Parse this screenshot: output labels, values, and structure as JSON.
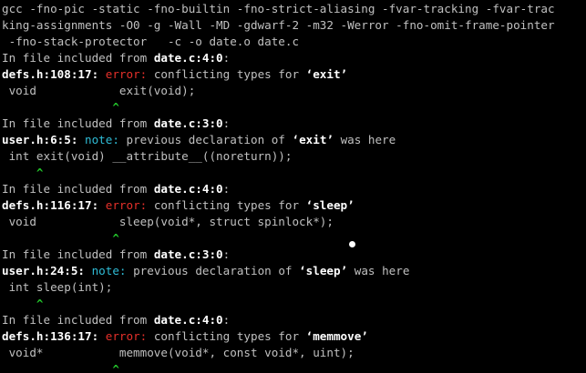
{
  "terminal": {
    "command": [
      "gcc -fno-pic -static -fno-builtin -fno-strict-aliasing -fvar-tracking -fvar-trac",
      "king-assignments -O0 -g -Wall -MD -gdwarf-2 -m32 -Werror -fno-omit-frame-pointer",
      " -fno-stack-protector   -c -o date.o date.c"
    ],
    "blocks": [
      {
        "included_prefix": "In file included from ",
        "included_file": "date.c:4:0",
        "included_suffix": ":",
        "location": "defs.h:108:17:",
        "kind": "error:",
        "message_before": " conflicting types for ",
        "symbol": "‘exit’",
        "message_after": "",
        "source": " void            exit(void);",
        "caret": "                ^"
      },
      {
        "included_prefix": "In file included from ",
        "included_file": "date.c:3:0",
        "included_suffix": ":",
        "location": "user.h:6:5:",
        "kind": "note:",
        "message_before": " previous declaration of ",
        "symbol": "‘exit’",
        "message_after": " was here",
        "source": " int exit(void) __attribute__((noreturn));",
        "caret": "     ^"
      },
      {
        "included_prefix": "In file included from ",
        "included_file": "date.c:4:0",
        "included_suffix": ":",
        "location": "defs.h:116:17:",
        "kind": "error:",
        "message_before": " conflicting types for ",
        "symbol": "‘sleep’",
        "message_after": "",
        "source": " void            sleep(void*, struct spinlock*);",
        "caret": "                ^"
      },
      {
        "included_prefix": "In file included from ",
        "included_file": "date.c:3:0",
        "included_suffix": ":",
        "location": "user.h:24:5:",
        "kind": "note:",
        "message_before": " previous declaration of ",
        "symbol": "‘sleep’",
        "message_after": " was here",
        "source": " int sleep(int);",
        "caret": "     ^"
      },
      {
        "included_prefix": "In file included from ",
        "included_file": "date.c:4:0",
        "included_suffix": ":",
        "location": "defs.h:136:17:",
        "kind": "error:",
        "message_before": " conflicting types for ",
        "symbol": "‘memmove’",
        "message_after": "",
        "source": " void*           memmove(void*, const void*, uint);",
        "caret": "                ^"
      }
    ]
  },
  "colors": {
    "background": "#000000",
    "text": "#c0c0c0",
    "bold_text": "#ffffff",
    "error": "#e5302a",
    "note": "#2fbcd6",
    "caret": "#22c12a"
  }
}
